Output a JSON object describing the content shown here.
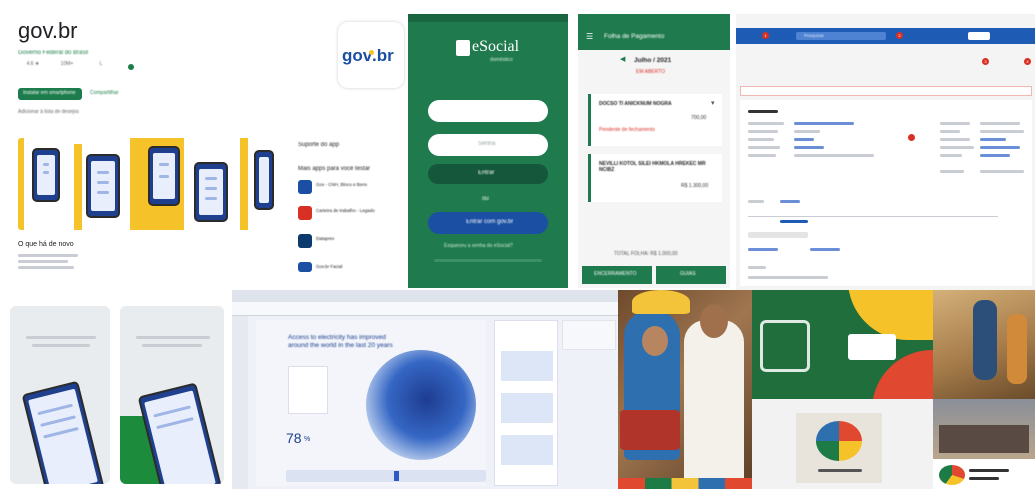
{
  "playstore": {
    "app_title": "gov.br",
    "developer": "Governo Federal do Brasil",
    "install_label": "Instalar em smartphone",
    "share_label": "Compartilhar",
    "wishlist_label": "Adicionar à lista de desejos",
    "about_title": "O que há de novo",
    "support_title": "Suporte do app",
    "similar_title": "Mais apps para você testar",
    "similar_apps": [
      "Gov - CNH, Bloco e Bens",
      "Carteira de trabalho - Legado",
      "Dataprev",
      "Gov.br Facial"
    ]
  },
  "govlogo": {
    "text_left": "gov",
    "text_right": ".br"
  },
  "esocial": {
    "brand": "eSocial",
    "brand_sub": "doméstico",
    "password_placeholder": "Senha",
    "enter_label": "Entrar",
    "or_label": "ou",
    "govbr_button": "Entrar com gov.br",
    "forgot_label": "Esqueceu a senha do eSocial?"
  },
  "folha": {
    "header_title": "Folha de Pagamento",
    "month_label": "Julho / 2021",
    "status": "EM ABERTO",
    "employee1_name": "DOCSO TI ANICKNUM NOGRA",
    "employee1_value": "700,00",
    "employee1_note": "Pendente de fechamento",
    "employee2_name": "NEVILLI KOTOL SILEI HKMOLA HREKEC MR NCIBZ",
    "employee2_value": "R$ 1.300,00",
    "total_label": "TOTAL FOLHA: R$ 1.000,00",
    "btn_left": "ENCERRAMENTO",
    "btn_right": "GUIAS"
  },
  "desktop": {
    "search_placeholder": "Pesquisar",
    "badge_numbers": [
      "1",
      "2",
      "3",
      "4"
    ]
  },
  "dashboard": {
    "headline": "Access to electricity has improved around the world in the last 20 years",
    "stat_value": "78",
    "stat_unit": "%"
  },
  "colors": {
    "gov_green": "#1c7c4b",
    "gov_blue": "#1a4fa3",
    "gov_yellow": "#f6c22a",
    "esocial_green": "#1f7a4d",
    "alert_red": "#d93025"
  }
}
